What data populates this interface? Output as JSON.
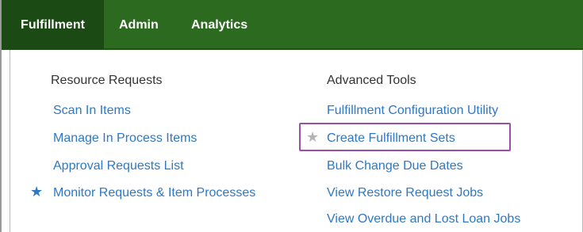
{
  "nav": {
    "tabs": [
      {
        "label": "Fulfillment",
        "active": true
      },
      {
        "label": "Admin",
        "active": false
      },
      {
        "label": "Analytics",
        "active": false
      }
    ]
  },
  "menu": {
    "resource_requests": {
      "heading": "Resource Requests",
      "items": [
        {
          "label": "Scan In Items",
          "starred": false
        },
        {
          "label": "Manage In Process Items",
          "starred": false
        },
        {
          "label": "Approval Requests List",
          "starred": false
        },
        {
          "label": "Monitor Requests & Item Processes",
          "starred": true
        }
      ]
    },
    "advanced_tools": {
      "heading": "Advanced Tools",
      "items": [
        {
          "label": "Fulfillment Configuration Utility",
          "starred": false
        },
        {
          "label": "Create Fulfillment Sets",
          "starred": false,
          "star_outline": true
        },
        {
          "label": "Bulk Change Due Dates",
          "starred": false
        },
        {
          "label": "View Restore Request Jobs",
          "starred": false
        },
        {
          "label": "View Overdue and Lost Loan Jobs",
          "starred": false
        }
      ]
    }
  },
  "colors": {
    "nav_bg": "#2c6a20",
    "link": "#2f78c4",
    "highlight": "#9b4fa6"
  }
}
